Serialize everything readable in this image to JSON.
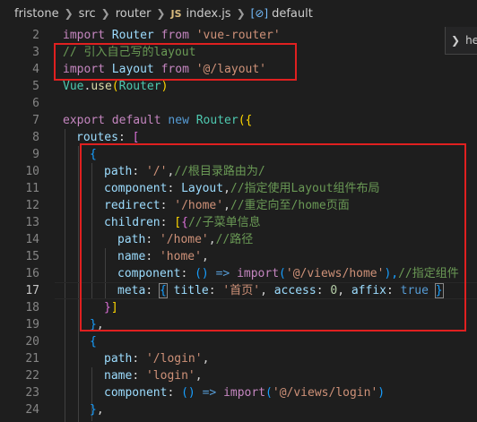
{
  "breadcrumb": {
    "items": [
      "fristone",
      "src",
      "router"
    ],
    "file_icon": "JS",
    "file": "index.js",
    "symbol_icon": "[⊘]",
    "symbol": "default"
  },
  "hover_widget": {
    "text": "he",
    "icon": "chevron-right-icon"
  },
  "editor": {
    "active_line": 17,
    "line_numbers": [
      "2",
      "3",
      "4",
      "5",
      "6",
      "7",
      "8",
      "9",
      "10",
      "11",
      "12",
      "13",
      "14",
      "15",
      "16",
      "17",
      "18",
      "19",
      "20",
      "21",
      "22",
      "23",
      "24"
    ],
    "lines": {
      "l2": [
        "import",
        "Router",
        "from",
        "'vue-router'"
      ],
      "l3": [
        "// 引入自己写的layout"
      ],
      "l4": [
        "import",
        "Layout",
        "from",
        "'@/layout'"
      ],
      "l5": [
        "Vue",
        ".",
        "use",
        "(",
        "Router",
        ")"
      ],
      "l7": [
        "export",
        "default",
        "new",
        "Router",
        "({"
      ],
      "l8": [
        "routes",
        ":",
        "["
      ],
      "l9": [
        "{"
      ],
      "l10": [
        "path",
        ":",
        "'/'",
        ",",
        "//根目录路由为/"
      ],
      "l11": [
        "component",
        ":",
        "Layout",
        ",",
        "//指定使用Layout组件布局"
      ],
      "l12": [
        "redirect",
        ":",
        "'/home'",
        ",",
        "//重定向至/home页面"
      ],
      "l13": [
        "children",
        ":",
        "[",
        "{",
        "//子菜单信息"
      ],
      "l14": [
        "path",
        ":",
        "'/home'",
        ",",
        "//路径"
      ],
      "l15": [
        "name",
        ":",
        "'home'",
        ","
      ],
      "l16": [
        "component",
        ":",
        "()",
        "=>",
        "import",
        "(",
        "'@/views/home'",
        "),",
        "//指定组件"
      ],
      "l17": [
        "meta",
        ":",
        "{",
        "title",
        ":",
        "'首页'",
        ",",
        "access",
        ":",
        "0",
        ",",
        "affix",
        ":",
        "true",
        "}"
      ],
      "l18": [
        "}",
        "]"
      ],
      "l19": [
        "}",
        ","
      ],
      "l20": [
        "{"
      ],
      "l21": [
        "path",
        ":",
        "'/login'",
        ","
      ],
      "l22": [
        "name",
        ":",
        "'login'",
        ","
      ],
      "l23": [
        "component",
        ":",
        "()",
        "=>",
        "import",
        "(",
        "'@/views/login'",
        ")"
      ],
      "l24": [
        "}",
        ","
      ]
    }
  },
  "annotations": {
    "color": "#e02020"
  }
}
